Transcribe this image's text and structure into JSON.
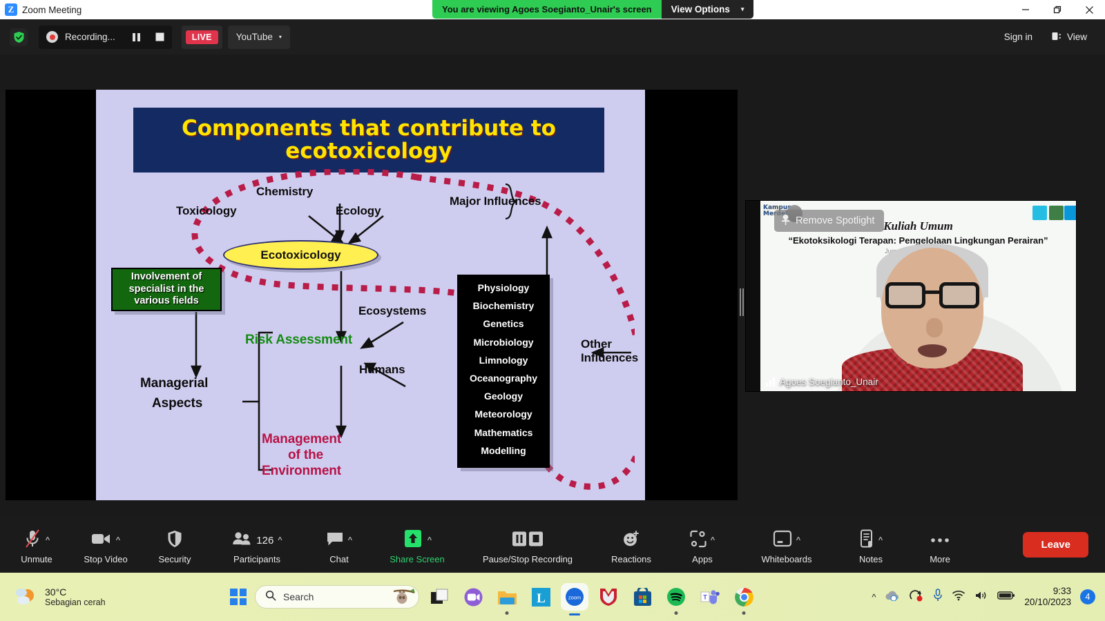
{
  "window": {
    "title": "Zoom Meeting",
    "logo_letter": "Z",
    "minimize": "minimize-icon",
    "maximize": "maximize-icon",
    "close": "close-icon"
  },
  "share_banner": {
    "message": "You are viewing Agoes Soegianto_Unair's screen",
    "view_options_label": "View Options",
    "chevron": "⌄"
  },
  "recording_bar": {
    "shield_icon": "shield-check-icon",
    "recording_label": "Recording...",
    "pause_icon": "pause-icon",
    "stop_icon": "stop-icon",
    "live_label": "LIVE",
    "platform_label": "YouTube",
    "platform_chevron": "▾",
    "sign_in_label": "Sign in",
    "view_label": "View"
  },
  "slide": {
    "title_line1": "Components that contribute to",
    "title_line2": "ecotoxicology",
    "center_node": "Ecotoxicology",
    "inputs": [
      "Toxicology",
      "Chemistry",
      "Ecology"
    ],
    "major_influences": "Major Influences",
    "other_influences_line1": "Other",
    "other_influences_line2": "Influences",
    "green_box": [
      "Involvement of",
      "specialist in the",
      "various fields"
    ],
    "disciplines": [
      "Physiology",
      "Biochemistry",
      "Genetics",
      "Microbiology",
      "Limnology",
      "Oceanography",
      "Geology",
      "Meteorology",
      "Mathematics",
      "Modelling"
    ],
    "risk_assessment": "Risk Assessment",
    "ecosystems": "Ecosystems",
    "humans": "Humans",
    "managerial_line1": "Managerial",
    "managerial_line2": "Aspects",
    "management_line1": "Management",
    "management_line2": "of the",
    "management_line3": "Environment",
    "colors": {
      "slide_bg": "#cfcdef",
      "title_bg": "#132a63",
      "title_text": "#ffe400",
      "ellipse_fill": "#ffef50",
      "green_box": "#12670f",
      "risk_green": "#138b13",
      "management_maroon": "#b61347",
      "loop_red": "#b81c48"
    }
  },
  "video_panel": {
    "spotlight_button": "Remove Spotlight",
    "spotlight_icon": "spotlight-pin-icon",
    "participant_name": "Agoes Soegianto_Unair",
    "audio_icon": "audio-level-icon",
    "background_kampus": "Kampus Merdeka",
    "background_kuliah": "Kuliah Umum",
    "background_subtitle": "“Ekotoksikologi Terapan: Pengelolaan Lingkungan Perairan”",
    "background_date": "Jumat, 20 Oktober 2023"
  },
  "controls": [
    {
      "name": "unmute",
      "label": "Unmute",
      "icon": "microphone-muted-icon",
      "caret": true,
      "green": false
    },
    {
      "name": "stop-video",
      "label": "Stop Video",
      "icon": "video-camera-icon",
      "caret": true,
      "green": false
    },
    {
      "name": "security",
      "label": "Security",
      "icon": "shield-icon",
      "caret": false,
      "green": false
    },
    {
      "name": "participants",
      "label": "Participants",
      "icon": "participants-icon",
      "caret": true,
      "green": false,
      "count": "126"
    },
    {
      "name": "chat",
      "label": "Chat",
      "icon": "chat-bubble-icon",
      "caret": true,
      "green": false
    },
    {
      "name": "share-screen",
      "label": "Share Screen",
      "icon": "share-screen-icon",
      "caret": true,
      "green": true
    },
    {
      "name": "recording",
      "label": "Pause/Stop Recording",
      "icon": "pause-stop-icon",
      "caret": false,
      "green": false
    },
    {
      "name": "reactions",
      "label": "Reactions",
      "icon": "reactions-icon",
      "caret": false,
      "green": false
    },
    {
      "name": "apps",
      "label": "Apps",
      "icon": "apps-icon",
      "caret": true,
      "green": false
    },
    {
      "name": "whiteboards",
      "label": "Whiteboards",
      "icon": "whiteboard-icon",
      "caret": true,
      "green": false
    },
    {
      "name": "notes",
      "label": "Notes",
      "icon": "notes-icon",
      "caret": true,
      "green": false
    },
    {
      "name": "more",
      "label": "More",
      "icon": "more-dots-icon",
      "caret": false,
      "green": false
    }
  ],
  "leave_button": "Leave",
  "taskbar": {
    "weather_temp": "30°C",
    "weather_desc": "Sebagian cerah",
    "weather_icon": "partly-cloudy-icon",
    "start_icon": "windows-start-icon",
    "search_placeholder": "Search",
    "search_icon": "search-icon",
    "search_mascot": "sloth-icon",
    "apps": [
      "file-explorer-dark-icon",
      "camera-app-icon",
      "folder-icon",
      "lightshot-icon",
      "zoom-app-icon",
      "mcafee-icon",
      "microsoft-store-icon",
      "spotify-icon",
      "microsoft-teams-icon",
      "google-chrome-icon"
    ],
    "tray_icons": [
      "chevron-up-icon",
      "onedrive-icon",
      "recording-tray-icon",
      "microphone-icon",
      "wifi-icon",
      "speaker-icon",
      "battery-icon"
    ],
    "clock_time": "9:33",
    "clock_date": "20/10/2023",
    "notification_count": "4"
  }
}
